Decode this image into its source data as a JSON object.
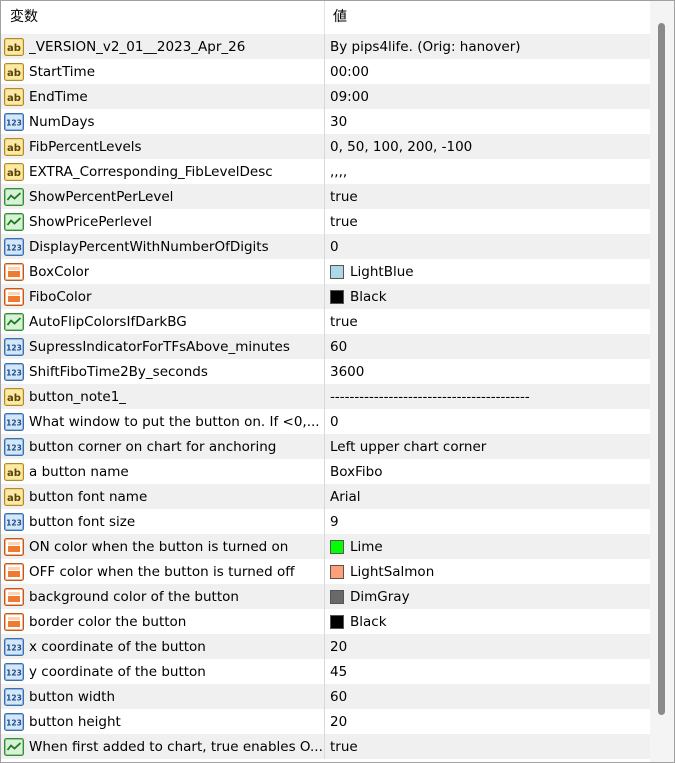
{
  "header": {
    "name_label": "変数",
    "value_label": "値"
  },
  "colors": {
    "LightBlue": "#add8e6",
    "Black": "#000000",
    "Lime": "#00ff00",
    "LightSalmon": "#ffa07a",
    "DimGray": "#696969"
  },
  "rows": [
    {
      "icon": "string-type-icon",
      "name": "_VERSION_v2_01__2023_Apr_26",
      "value": "By pips4life. (Orig: hanover)"
    },
    {
      "icon": "string-type-icon",
      "name": "StartTime",
      "value": "00:00"
    },
    {
      "icon": "string-type-icon",
      "name": "EndTime",
      "value": "09:00"
    },
    {
      "icon": "integer-type-icon",
      "name": "NumDays",
      "value": "30"
    },
    {
      "icon": "string-type-icon",
      "name": "FibPercentLevels",
      "value": "0, 50, 100, 200, -100"
    },
    {
      "icon": "string-type-icon",
      "name": "EXTRA_Corresponding_FibLevelDesc",
      "value": ",,,,"
    },
    {
      "icon": "boolean-type-icon",
      "name": "ShowPercentPerLevel",
      "value": "true"
    },
    {
      "icon": "boolean-type-icon",
      "name": "ShowPricePerlevel",
      "value": "true"
    },
    {
      "icon": "integer-type-icon",
      "name": "DisplayPercentWithNumberOfDigits",
      "value": "0"
    },
    {
      "icon": "color-type-icon",
      "name": "BoxColor",
      "value": "LightBlue",
      "swatch": "LightBlue"
    },
    {
      "icon": "color-type-icon",
      "name": "FiboColor",
      "value": "Black",
      "swatch": "Black"
    },
    {
      "icon": "boolean-type-icon",
      "name": "AutoFlipColorsIfDarkBG",
      "value": "true"
    },
    {
      "icon": "integer-type-icon",
      "name": "SupressIndicatorForTFsAbove_minutes",
      "value": "60"
    },
    {
      "icon": "integer-type-icon",
      "name": "ShiftFiboTime2By_seconds",
      "value": "3600"
    },
    {
      "icon": "string-type-icon",
      "name": "button_note1_",
      "value": "-----------------------------------------"
    },
    {
      "icon": "integer-type-icon",
      "name": "What window to put the button on.  If <0,...",
      "value": "0"
    },
    {
      "icon": "integer-type-icon",
      "name": "button corner on chart for anchoring",
      "value": "Left upper chart corner"
    },
    {
      "icon": "string-type-icon",
      "name": "a button name",
      "value": "BoxFibo"
    },
    {
      "icon": "string-type-icon",
      "name": "button font name",
      "value": "Arial"
    },
    {
      "icon": "integer-type-icon",
      "name": "button font size",
      "value": "9"
    },
    {
      "icon": "color-type-icon",
      "name": "ON color when the button is turned on",
      "value": "Lime",
      "swatch": "Lime"
    },
    {
      "icon": "color-type-icon",
      "name": "OFF color when the button is turned off",
      "value": "LightSalmon",
      "swatch": "LightSalmon"
    },
    {
      "icon": "color-type-icon",
      "name": "background color of the button",
      "value": "DimGray",
      "swatch": "DimGray"
    },
    {
      "icon": "color-type-icon",
      "name": "border color the button",
      "value": "Black",
      "swatch": "Black"
    },
    {
      "icon": "integer-type-icon",
      "name": "x coordinate of the button",
      "value": "20"
    },
    {
      "icon": "integer-type-icon",
      "name": "y coordinate of the button",
      "value": "45"
    },
    {
      "icon": "integer-type-icon",
      "name": "button width",
      "value": "60"
    },
    {
      "icon": "integer-type-icon",
      "name": "button height",
      "value": "20"
    },
    {
      "icon": "boolean-type-icon",
      "name": "When first added to chart, true enables O...",
      "value": "true"
    }
  ]
}
